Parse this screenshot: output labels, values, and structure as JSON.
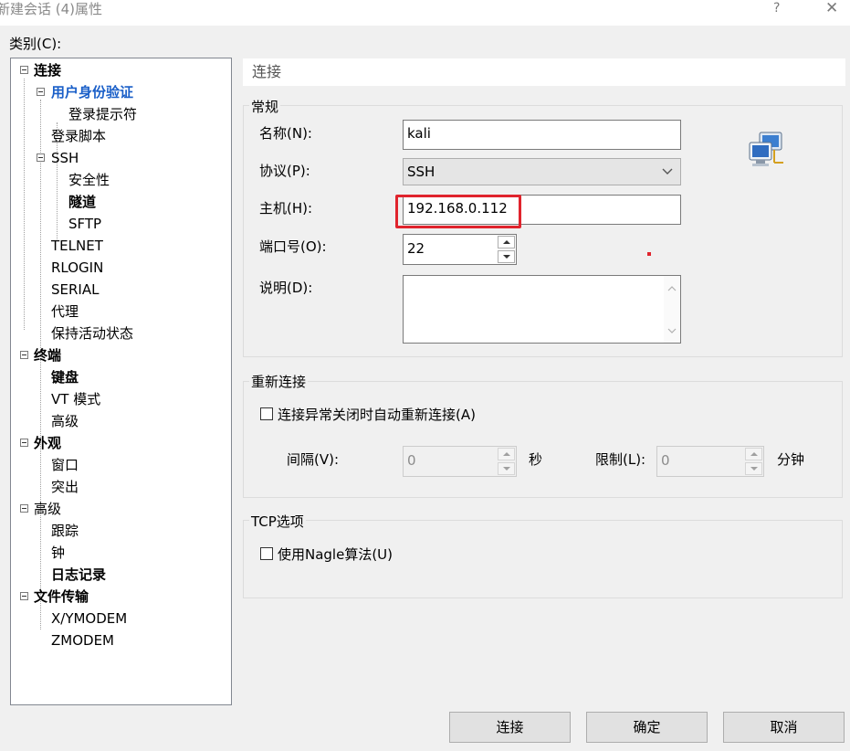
{
  "window": {
    "title": "新建会话 (4)属性",
    "help": "?",
    "close": "✕"
  },
  "category_label": "类别(C):",
  "tree": [
    {
      "label": "连接",
      "bold": true
    },
    {
      "label": "用户身份验证",
      "bold": true,
      "selected": true
    },
    {
      "label": "登录提示符"
    },
    {
      "label": "登录脚本"
    },
    {
      "label": "SSH"
    },
    {
      "label": "安全性"
    },
    {
      "label": "隧道",
      "bold": true
    },
    {
      "label": "SFTP"
    },
    {
      "label": "TELNET"
    },
    {
      "label": "RLOGIN"
    },
    {
      "label": "SERIAL"
    },
    {
      "label": "代理"
    },
    {
      "label": "保持活动状态"
    },
    {
      "label": "终端",
      "bold": true
    },
    {
      "label": "键盘",
      "bold": true
    },
    {
      "label": "VT 模式"
    },
    {
      "label": "高级"
    },
    {
      "label": "外观",
      "bold": true
    },
    {
      "label": "窗口"
    },
    {
      "label": "突出"
    },
    {
      "label": "高级"
    },
    {
      "label": "跟踪"
    },
    {
      "label": "钟"
    },
    {
      "label": "日志记录",
      "bold": true
    },
    {
      "label": "文件传输",
      "bold": true
    },
    {
      "label": "X/YMODEM"
    },
    {
      "label": "ZMODEM"
    }
  ],
  "panel": {
    "header": "连接",
    "general": {
      "title": "常规",
      "name_label": "名称(N):",
      "name_value": "kali",
      "protocol_label": "协议(P):",
      "protocol_value": "SSH",
      "host_label": "主机(H):",
      "host_value": "192.168.0.112",
      "port_label": "端口号(O):",
      "port_value": "22",
      "desc_label": "说明(D):",
      "desc_value": ""
    },
    "reconnect": {
      "title": "重新连接",
      "checkbox_label": "连接异常关闭时自动重新连接(A)",
      "interval_label": "间隔(V):",
      "interval_value": "0",
      "interval_unit": "秒",
      "limit_label": "限制(L):",
      "limit_value": "0",
      "limit_unit": "分钟"
    },
    "tcp": {
      "title": "TCP选项",
      "nagle_label": "使用Nagle算法(U)"
    }
  },
  "buttons": {
    "connect": "连接",
    "ok": "确定",
    "cancel": "取消"
  },
  "icons": {
    "session_icon": "network-computers-icon"
  },
  "colors": {
    "highlight": "#e0242d",
    "selected_text": "#1a5fc8"
  }
}
